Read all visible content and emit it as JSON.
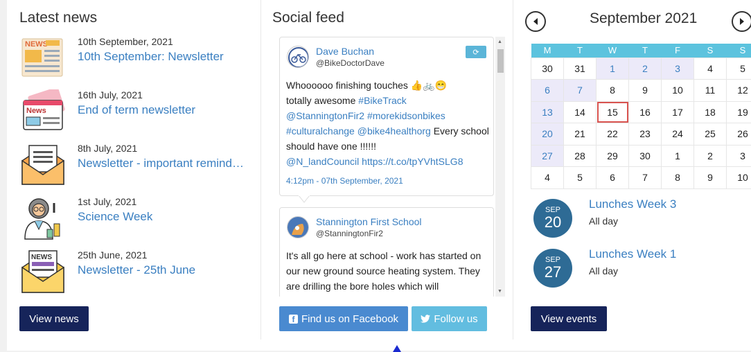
{
  "news": {
    "heading": "Latest news",
    "items": [
      {
        "date": "10th September, 2021",
        "title": "10th September: Newsletter"
      },
      {
        "date": "16th July, 2021",
        "title": "End of term newsletter"
      },
      {
        "date": "8th July, 2021",
        "title": "Newsletter - important reminders"
      },
      {
        "date": "1st July, 2021",
        "title": "Science Week"
      },
      {
        "date": "25th June, 2021",
        "title": "Newsletter - 25th June"
      }
    ],
    "view_button": "View news"
  },
  "social": {
    "heading": "Social feed",
    "tweets": [
      {
        "name": "Dave Buchan",
        "handle": "@BikeDoctorDave",
        "text_a": "Whoooooo finishing touches 👍🚲😁",
        "text_b": "totally awesome ",
        "tag1": "#BikeTrack",
        "tag2": "@StanningtonFir2",
        "tag3": "#morekidsonbikes",
        "tag4": "#culturalchange",
        "tag5": "@bike4healthorg",
        "text_c": " Every school should have one !!!!!!",
        "tag6": "@N_landCouncil",
        "tag7": "https://t.co/tpYVhtSLG8",
        "time": "4:12pm - 07th September, 2021"
      },
      {
        "name": "Stannington First School",
        "handle": "@StanningtonFir2",
        "text": "It's all go here at school - work has started on our new ground source heating system. They are drilling the bore holes which will"
      }
    ],
    "facebook_button": "Find us on Facebook",
    "twitter_button": "Follow us"
  },
  "calendar": {
    "title": "September 2021",
    "weekdays": [
      "M",
      "T",
      "W",
      "T",
      "F",
      "S",
      "S"
    ],
    "weeks": [
      [
        {
          "d": "30",
          "o": true
        },
        {
          "d": "31",
          "o": true
        },
        {
          "d": "1",
          "e": true
        },
        {
          "d": "2",
          "e": true
        },
        {
          "d": "3",
          "e": true
        },
        {
          "d": "4"
        },
        {
          "d": "5"
        }
      ],
      [
        {
          "d": "6",
          "e": true
        },
        {
          "d": "7",
          "e": true
        },
        {
          "d": "8"
        },
        {
          "d": "9"
        },
        {
          "d": "10"
        },
        {
          "d": "11"
        },
        {
          "d": "12"
        }
      ],
      [
        {
          "d": "13",
          "e": true
        },
        {
          "d": "14"
        },
        {
          "d": "15",
          "t": true
        },
        {
          "d": "16"
        },
        {
          "d": "17"
        },
        {
          "d": "18"
        },
        {
          "d": "19"
        }
      ],
      [
        {
          "d": "20",
          "e": true
        },
        {
          "d": "21"
        },
        {
          "d": "22"
        },
        {
          "d": "23"
        },
        {
          "d": "24"
        },
        {
          "d": "25"
        },
        {
          "d": "26"
        }
      ],
      [
        {
          "d": "27",
          "e": true
        },
        {
          "d": "28"
        },
        {
          "d": "29"
        },
        {
          "d": "30"
        },
        {
          "d": "1",
          "o": true
        },
        {
          "d": "2",
          "o": true
        },
        {
          "d": "3",
          "o": true
        }
      ],
      [
        {
          "d": "4",
          "o": true
        },
        {
          "d": "5",
          "o": true
        },
        {
          "d": "6",
          "o": true
        },
        {
          "d": "7",
          "o": true
        },
        {
          "d": "8",
          "o": true
        },
        {
          "d": "9",
          "o": true
        },
        {
          "d": "10",
          "o": true
        }
      ]
    ],
    "events": [
      {
        "month": "SEP",
        "day": "20",
        "title": "Lunches Week 3",
        "time": "All day"
      },
      {
        "month": "SEP",
        "day": "27",
        "title": "Lunches Week 1",
        "time": "All day"
      }
    ],
    "view_button": "View events"
  },
  "colors": {
    "accent": "#3a7fc1",
    "navy": "#16245a",
    "calendar_header": "#5cc3de",
    "facebook": "#4a8ad0",
    "twitter": "#62bde0"
  }
}
